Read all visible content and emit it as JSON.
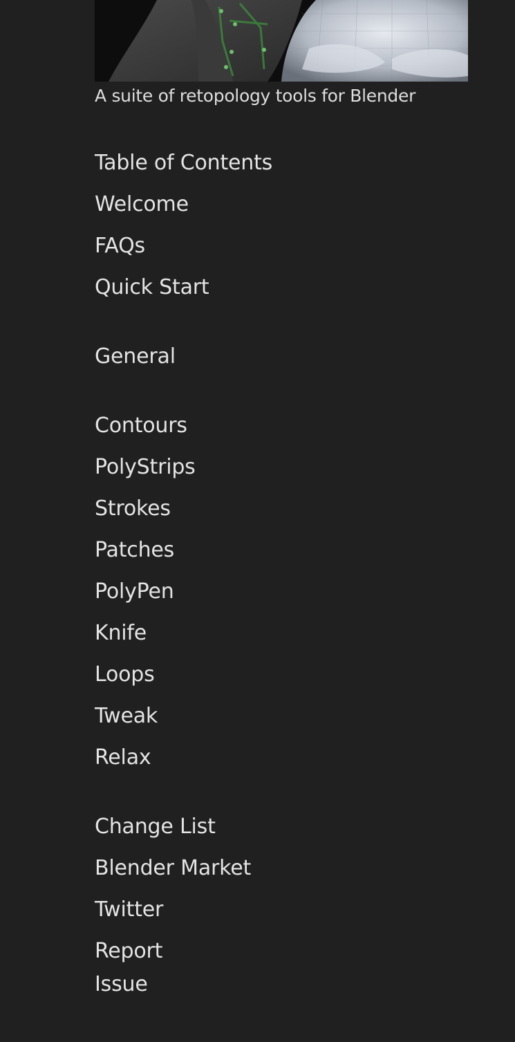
{
  "header": {
    "banner_image": "retopology-banner-image",
    "tagline": "A suite of retopology tools for Blender"
  },
  "nav": {
    "group_main": [
      {
        "label": "Table of Contents"
      },
      {
        "label": "Welcome"
      },
      {
        "label": "FAQs"
      },
      {
        "label": "Quick Start"
      }
    ],
    "group_general": [
      {
        "label": "General"
      }
    ],
    "group_tools": [
      {
        "label": "Contours"
      },
      {
        "label": "PolyStrips"
      },
      {
        "label": "Strokes"
      },
      {
        "label": "Patches"
      },
      {
        "label": "PolyPen"
      },
      {
        "label": "Knife"
      },
      {
        "label": "Loops"
      },
      {
        "label": "Tweak"
      },
      {
        "label": "Relax"
      }
    ],
    "group_links": [
      {
        "label": "Change List"
      },
      {
        "label": "Blender Market"
      },
      {
        "label": "Twitter"
      },
      {
        "label": "Report Issue"
      }
    ]
  },
  "colors": {
    "background": "#202020",
    "text": "#e4e4e4",
    "mesh_green": "#3c8a3c"
  }
}
